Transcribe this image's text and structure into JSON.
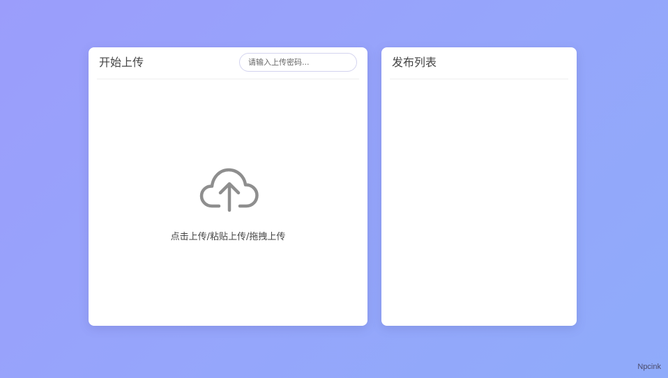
{
  "upload_panel": {
    "title": "开始上传",
    "password_input": {
      "placeholder": "请输入上传密码...",
      "value": ""
    },
    "icon": "cloud-upload-icon",
    "hint": "点击上传/粘贴上传/拖拽上传"
  },
  "list_panel": {
    "title": "发布列表",
    "items": []
  },
  "footer": {
    "brand": "Npcink"
  },
  "colors": {
    "background_start": "#9b9dfb",
    "background_end": "#8fabfa",
    "panel": "#ffffff",
    "icon": "#8e8e8e"
  }
}
